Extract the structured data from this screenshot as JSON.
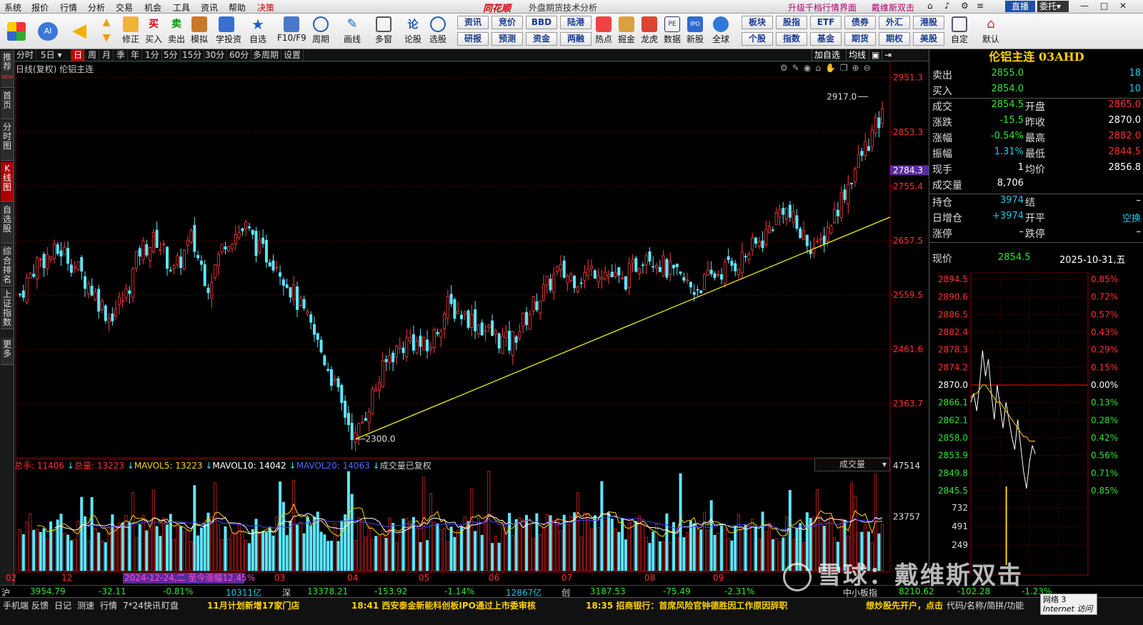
{
  "menubar": {
    "items": [
      "系统",
      "报价",
      "行情",
      "分析",
      "交易",
      "机会",
      "工具",
      "资讯",
      "帮助",
      "决策"
    ],
    "app_title": "同花顺",
    "subtitle": "外盘期货技术分析",
    "right_links": [
      "升级千档行情界面",
      "戴维斯双击"
    ],
    "zhibo": "直播",
    "weituo": "委托"
  },
  "toolbar": {
    "buttons": [
      "修正",
      "买入",
      "卖出",
      "模拟",
      "学投资",
      "自选",
      "F10/F9",
      "周期",
      "画线",
      "多窗",
      "论股",
      "选股"
    ],
    "small_buttons_row1": [
      "资讯",
      "竞价",
      "BBD",
      "陆港"
    ],
    "small_buttons_row2": [
      "研报",
      "预测",
      "资金",
      "两融"
    ],
    "buttons2": [
      "热点",
      "掘金",
      "龙虎",
      "数据",
      "新股",
      "全球"
    ],
    "small_buttons2_row1": [
      "板块",
      "股指",
      "ETF",
      "债券",
      "外汇",
      "港股"
    ],
    "small_buttons2_row2": [
      "个股",
      "指数",
      "基金",
      "期货",
      "期权",
      "美股"
    ],
    "buttons3": [
      "自定",
      "默认"
    ]
  },
  "left_tabs": [
    "推荐",
    "首页",
    "分时图",
    "K线图",
    "自选股",
    "综合排名",
    "上证指数",
    "更多"
  ],
  "left_tab_new": "NEW",
  "periods": [
    "分时",
    "5日",
    "日",
    "周",
    "月",
    "季",
    "年",
    "1分",
    "5分",
    "15分",
    "30分",
    "60分",
    "多周期",
    "设置"
  ],
  "top_right_btns": [
    "加自选",
    "均线"
  ],
  "chart_label": "日线(复权)  伦铝主连",
  "volume_bar": {
    "zongshou_label": "总手:",
    "zongshou": "11406",
    "zongliang_label": "总量:",
    "zongliang": "13223",
    "mavol5_label": "MAVOL5:",
    "mavol5": "13223",
    "mavol10_label": "MAVOL10:",
    "mavol10": "14042",
    "mavol20_label": "MAVOL20:",
    "mavol20": "14063",
    "note": "成交量已复权",
    "selector": "成交量"
  },
  "chart_data": {
    "type": "candlestick",
    "price_axis": [
      "2951.3",
      "2853.3",
      "2784.3",
      "2755.4",
      "2657.5",
      "2559.5",
      "2461.6",
      "2363.7"
    ],
    "price_ylim": [
      2270,
      2965
    ],
    "current_price_label": "2784.3",
    "high_annotation": "2917.0",
    "low_annotation": "2300.0",
    "volume_axis": [
      "47514",
      "23757"
    ],
    "volume_ylim": [
      0,
      47514
    ],
    "x_labels": [
      "02",
      "12",
      "03",
      "04",
      "05",
      "06",
      "07",
      "08",
      "09"
    ],
    "highlight_label": "2024-12-24,二 至今涨幅12.45%",
    "trendline": {
      "from": [
        2300,
        2300
      ],
      "to_price_at_end": 2700
    },
    "ma_colors": [
      "#ffd200",
      "#ffffff",
      "#4444ff"
    ]
  },
  "right_panel": {
    "title": "伦铝主连  03AHD",
    "rows": [
      {
        "l": "卖出",
        "v": "2855.0",
        "v2": "18"
      },
      {
        "l": "买入",
        "v": "2854.0",
        "v2": "10"
      },
      {
        "l": "成交",
        "v": "2854.5",
        "l2": "开盘",
        "v2": "2865.0"
      },
      {
        "l": "涨跌",
        "v": "-15.5",
        "l2": "昨收",
        "v2": "2870.0"
      },
      {
        "l": "涨幅",
        "v": "-0.54%",
        "l2": "最高",
        "v2": "2882.0"
      },
      {
        "l": "振幅",
        "v": "1.31%",
        "l2": "最低",
        "v2": "2844.5"
      },
      {
        "l": "现手",
        "v": "1",
        "l2": "均价",
        "v2": "2856.8"
      },
      {
        "l": "成交量",
        "v": "8,706"
      },
      {
        "l": "持仓",
        "v": "3974",
        "l2": "结",
        "v2": "–"
      },
      {
        "l": "日增仓",
        "v": "+3974",
        "l2": "开平",
        "v2": "空换"
      },
      {
        "l": "涨停",
        "v": "–",
        "l2": "跌停",
        "v2": "–"
      }
    ],
    "xianjia_label": "现价",
    "xianjia": "2854.5",
    "date": "2025-10-31,五",
    "intraday_left": [
      "2894.5",
      "2890.6",
      "2886.5",
      "2882.4",
      "2878.3",
      "2874.2",
      "2870.0",
      "2866.1",
      "2862.1",
      "2858.0",
      "2853.9",
      "2849.8",
      "2845.5"
    ],
    "intraday_right": [
      "0.85%",
      "0.72%",
      "0.57%",
      "0.43%",
      "0.29%",
      "0.15%",
      "0.00%",
      "0.13%",
      "0.28%",
      "0.42%",
      "0.56%",
      "0.71%",
      "0.85%"
    ],
    "intraday_vol": [
      "732",
      "491",
      "249"
    ]
  },
  "index_bar": {
    "hu_label": "沪",
    "hu": "3954.79",
    "hu_chg": "-32.11",
    "hu_pct": "-0.81%",
    "hu_amt": "10311亿",
    "shen_label": "深",
    "shen": "13378.21",
    "shen_chg": "-153.92",
    "shen_pct": "-1.14%",
    "shen_amt": "12867亿",
    "chuang_label": "创",
    "chuang": "3187.53",
    "chuang_chg": "-75.49",
    "chuang_pct": "-2.31%",
    "zx_label": "中小板指",
    "zx": "8210.62",
    "zx_chg": "-102.28",
    "zx_pct": "-1.23%"
  },
  "statusbar": {
    "items": [
      "手机端",
      "反馈",
      "日记",
      "测速",
      "行情",
      "7*24快讯",
      "盯盘"
    ],
    "news1": "11月计划新增17家门店",
    "news2": "18:41 西安泰金新能科创板IPO通过上市委审核",
    "news3": "18:35 招商银行：首席风险官钟德胜因工作原因辞职",
    "news4": "想炒股先开户，点击",
    "right": "代码/名称/简拼/功能",
    "net": "网络 3",
    "net2": "Internet 访问"
  },
  "watermark": "雪球：戴维斯双击"
}
